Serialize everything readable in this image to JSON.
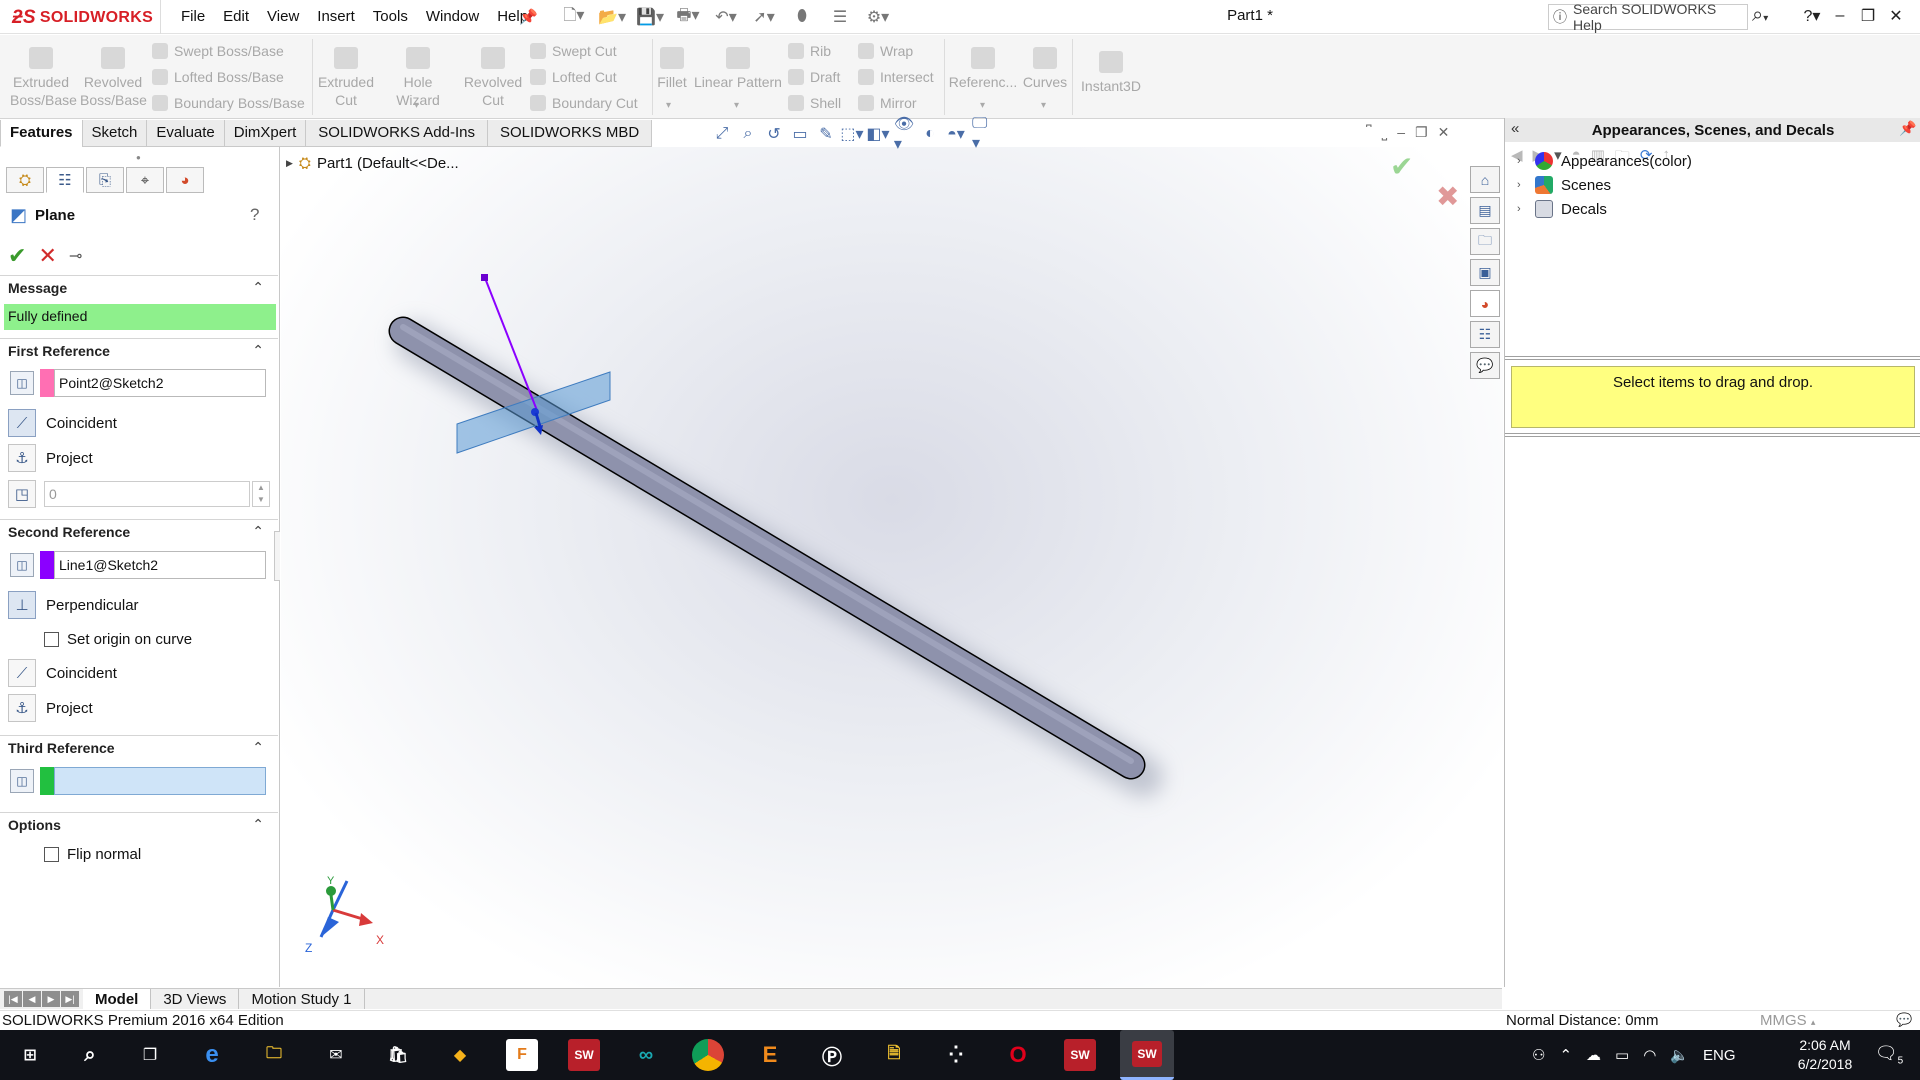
{
  "app": {
    "brand": "SOLIDWORKS",
    "document_title": "Part1 *",
    "accent_color": "#d71f26"
  },
  "menu": [
    "File",
    "Edit",
    "View",
    "Insert",
    "Tools",
    "Window",
    "Help"
  ],
  "search": {
    "placeholder": "Search SOLIDWORKS Help"
  },
  "command_manager": {
    "extruded_boss": "Extruded\nBoss/Base",
    "revolved_boss": "Revolved\nBoss/Base",
    "swept_boss": "Swept Boss/Base",
    "lofted_boss": "Lofted Boss/Base",
    "boundary_boss": "Boundary Boss/Base",
    "extruded_cut": "Extruded\nCut",
    "hole_wizard": "Hole Wizard",
    "revolved_cut": "Revolved\nCut",
    "swept_cut": "Swept Cut",
    "lofted_cut": "Lofted Cut",
    "boundary_cut": "Boundary Cut",
    "fillet": "Fillet",
    "linear_pattern": "Linear Pattern",
    "rib": "Rib",
    "draft": "Draft",
    "shell": "Shell",
    "wrap": "Wrap",
    "intersect": "Intersect",
    "mirror": "Mirror",
    "reference": "Referenc...",
    "curves": "Curves",
    "instant3d": "Instant3D"
  },
  "cm_tabs": [
    "Features",
    "Sketch",
    "Evaluate",
    "DimXpert",
    "SOLIDWORKS Add-Ins",
    "SOLIDWORKS MBD"
  ],
  "feature_tree": {
    "root": "Part1  (Default<<De..."
  },
  "property_manager": {
    "title": "Plane",
    "help": "?",
    "message_header": "Message",
    "message": "Fully defined",
    "message_color": "#8ef08c",
    "first_reference": {
      "header": "First Reference",
      "value": "Point2@Sketch2",
      "color": "#ff6fb3",
      "constraint_1": "Coincident",
      "constraint_2": "Project",
      "angle_value": "0"
    },
    "second_reference": {
      "header": "Second Reference",
      "value": "Line1@Sketch2",
      "color": "#8b00ff",
      "constraint_1": "Perpendicular",
      "option": "Set origin on curve",
      "constraint_2": "Coincident",
      "constraint_3": "Project"
    },
    "third_reference": {
      "header": "Third Reference",
      "value": "",
      "color": "#22c040"
    },
    "options": {
      "header": "Options",
      "flip_normal": "Flip normal"
    }
  },
  "task_pane": {
    "title": "Appearances, Scenes, and Decals",
    "items": [
      "Appearances(color)",
      "Scenes",
      "Decals"
    ],
    "drop_hint": "Select items to drag and drop."
  },
  "bottom_tabs": [
    "Model",
    "3D Views",
    "Motion Study 1"
  ],
  "status": {
    "edition": "SOLIDWORKS Premium 2016 x64 Edition",
    "normal_distance": "Normal Distance: 0mm",
    "units": "MMGS"
  },
  "triad": {
    "x": "X",
    "y": "Y",
    "z": "Z"
  },
  "taskbar": {
    "language": "ENG",
    "time": "2:06 AM",
    "date": "6/2/2018",
    "notification_count": "5"
  }
}
